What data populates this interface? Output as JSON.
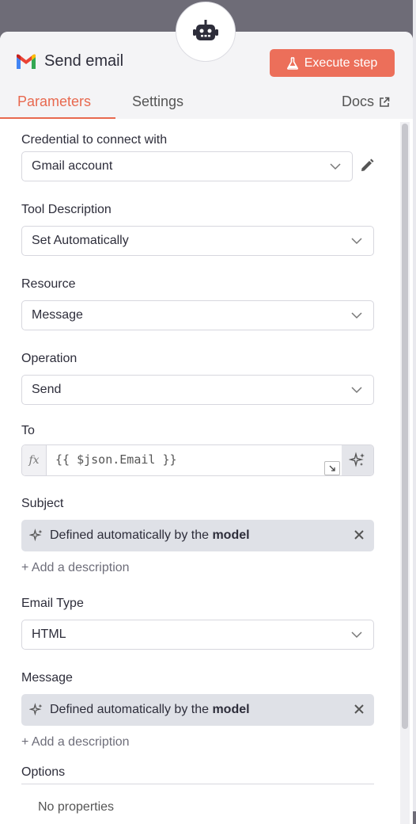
{
  "header": {
    "title": "Send email",
    "execute_label": "Execute step",
    "tabs": [
      {
        "label": "Parameters",
        "active": true
      },
      {
        "label": "Settings",
        "active": false
      }
    ],
    "docs_label": "Docs"
  },
  "fields": {
    "credential": {
      "label": "Credential to connect with",
      "value": "Gmail account"
    },
    "tool_description": {
      "label": "Tool Description",
      "value": "Set Automatically"
    },
    "resource": {
      "label": "Resource",
      "value": "Message"
    },
    "operation": {
      "label": "Operation",
      "value": "Send"
    },
    "to": {
      "label": "To",
      "fx": "fx",
      "value": "{{ $json.Email }}"
    },
    "subject": {
      "label": "Subject",
      "auto_prefix": "Defined automatically by the",
      "auto_bold": "model",
      "add_desc": "+ Add a description"
    },
    "email_type": {
      "label": "Email Type",
      "value": "HTML"
    },
    "message": {
      "label": "Message",
      "auto_prefix": "Defined automatically by the",
      "auto_bold": "model",
      "add_desc": "+ Add a description"
    },
    "options": {
      "label": "Options",
      "empty": "No properties"
    }
  },
  "colors": {
    "accent": "#ec6f5a",
    "tab_active": "#e8694f",
    "auto_bg": "#dfe1e7"
  },
  "icons": [
    "robot-icon",
    "gmail-icon",
    "flask-icon",
    "external-link-icon",
    "chevron-down-icon",
    "pencil-icon",
    "sparkles-icon",
    "expand-icon",
    "close-icon"
  ]
}
